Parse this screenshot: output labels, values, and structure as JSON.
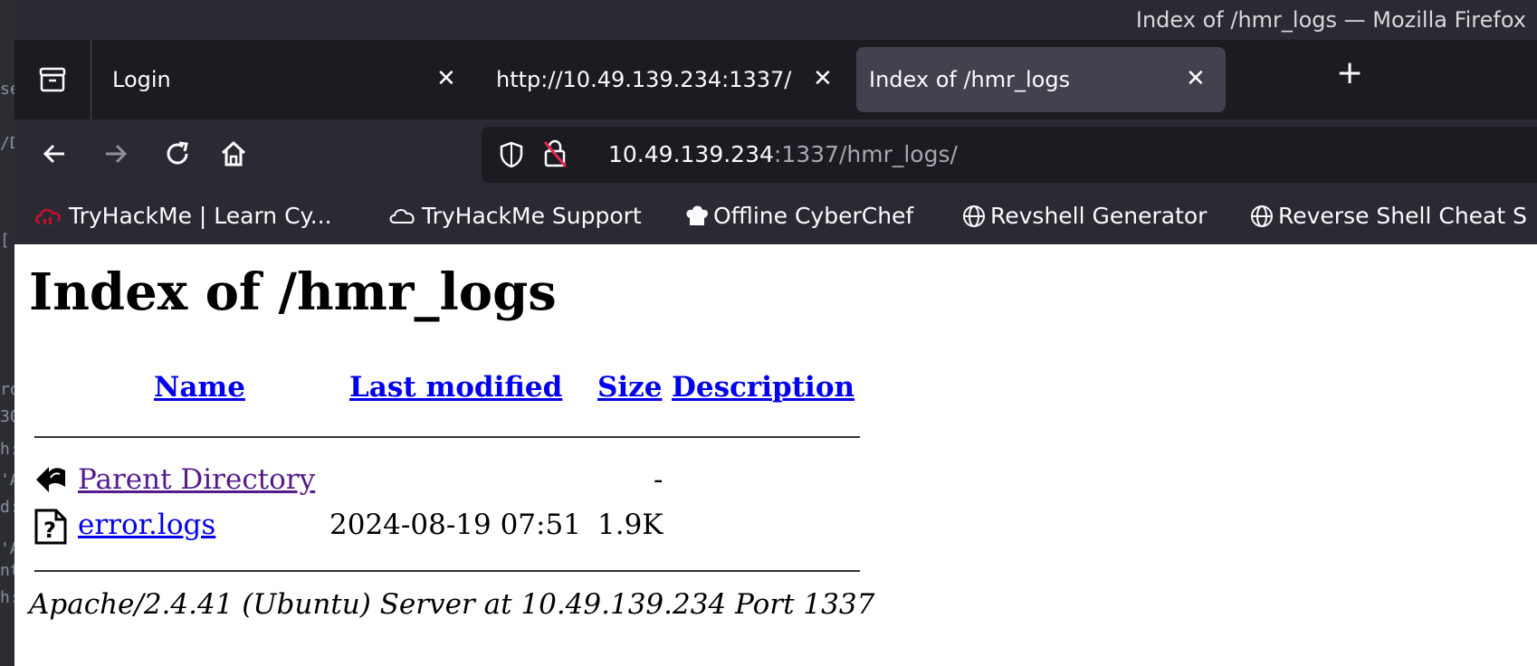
{
  "window_title": "Index of /hmr_logs — Mozilla Firefox",
  "tabs": [
    {
      "label": "Login",
      "active": false
    },
    {
      "label": "http://10.49.139.234:1337/",
      "active": false
    },
    {
      "label": "Index of /hmr_logs",
      "active": true
    }
  ],
  "url": {
    "host": "10.49.139.234",
    "rest": ":1337/hmr_logs/"
  },
  "bookmarks": [
    {
      "label": "TryHackMe | Learn Cy...",
      "icon": "tryhackme-icon"
    },
    {
      "label": "TryHackMe Support",
      "icon": "cloud-icon"
    },
    {
      "label": "Offline CyberChef",
      "icon": "chef-hat-icon"
    },
    {
      "label": "Revshell Generator",
      "icon": "globe-icon"
    },
    {
      "label": "Reverse Shell Cheat S",
      "icon": "globe-icon"
    }
  ],
  "page": {
    "heading": "Index of /hmr_logs",
    "columns": {
      "name": "Name",
      "last_modified": "Last modified",
      "size": "Size",
      "description": "Description"
    },
    "rows": [
      {
        "name": "Parent Directory",
        "last_modified": "",
        "size": "-",
        "icon": "back-arrow-icon"
      },
      {
        "name": "error.logs",
        "last_modified": "2024-08-19 07:51",
        "size": "1.9K",
        "icon": "unknown-file-icon"
      }
    ],
    "server_signature": "Apache/2.4.41 (Ubuntu) Server at 10.49.139.234 Port 1337"
  },
  "colors": {
    "link": "#0000ee",
    "visited": "#551a8b",
    "chrome_dark": "#1c1b22",
    "chrome": "#2b2a33"
  }
}
